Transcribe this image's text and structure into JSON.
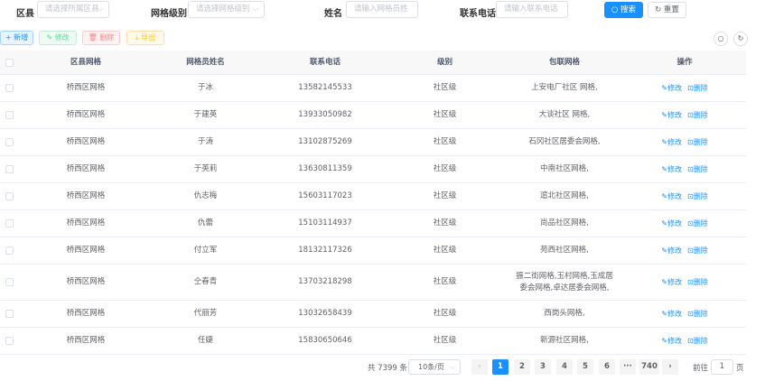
{
  "search": {
    "district_label": "区县",
    "district_placeholder": "请选择所属区县",
    "grid_level_label": "网格级别",
    "grid_level_placeholder": "请选择网格级别",
    "name_label": "姓名",
    "name_placeholder": "请输入网格员姓",
    "phone_label": "联系电话",
    "phone_placeholder": "请输入联系电话",
    "search_button": "搜索",
    "reset_button": "重置"
  },
  "toolbar": {
    "add": "+ 新增",
    "edit": "修改",
    "delete": "删除",
    "export": "导出"
  },
  "table": {
    "headers": [
      "区县网格",
      "网格员姓名",
      "联系电话",
      "级别",
      "包联网格",
      "操作"
    ],
    "edit_label": "修改",
    "delete_label": "删除",
    "rows": [
      {
        "district": "桥西区网格",
        "name": "于冰",
        "phone": "13582145533",
        "level": "社区级",
        "grids": "上安电厂社区 网格,"
      },
      {
        "district": "桥西区网格",
        "name": "于建英",
        "phone": "13933050982",
        "level": "社区级",
        "grids": "大谈社区 网格,"
      },
      {
        "district": "桥西区网格",
        "name": "于涛",
        "phone": "13102875269",
        "level": "社区级",
        "grids": "石冈社区居委会网格,"
      },
      {
        "district": "桥西区网格",
        "name": "于英莉",
        "phone": "13630811359",
        "level": "社区级",
        "grids": "中南社区网格,"
      },
      {
        "district": "桥西区网格",
        "name": "仇志梅",
        "phone": "15603117023",
        "level": "社区级",
        "grids": "逭北社区网格,"
      },
      {
        "district": "桥西区网格",
        "name": "仇蕾",
        "phone": "15103114937",
        "level": "社区级",
        "grids": "尚品社区网格,"
      },
      {
        "district": "桥西区网格",
        "name": "付立军",
        "phone": "18132117326",
        "level": "社区级",
        "grids": "苑西社区网格,"
      },
      {
        "district": "桥西区网格",
        "name": "仝春青",
        "phone": "13703218298",
        "level": "社区级",
        "grids": "振二街网格,玉村网格,玉成居委会网格,卓达居委会网格,"
      },
      {
        "district": "桥西区网格",
        "name": "代丽芳",
        "phone": "13032658439",
        "level": "社区级",
        "grids": "西岗头网格,"
      },
      {
        "district": "桥西区网格",
        "name": "任婕",
        "phone": "15830650646",
        "level": "社区级",
        "grids": "新源社区网格,"
      }
    ]
  },
  "pagination": {
    "total": "共 7399 条",
    "page_size": "10条/页",
    "pages": [
      "1",
      "2",
      "3",
      "4",
      "5",
      "6"
    ],
    "ellipsis": "···",
    "last_page": "740",
    "goto_label": "前往",
    "goto_value": "1",
    "goto_suffix": "页"
  },
  "colors": {
    "primary": "#1890ff",
    "success": "#13ce66",
    "danger": "#ff4949",
    "warning": "#ffba00"
  }
}
